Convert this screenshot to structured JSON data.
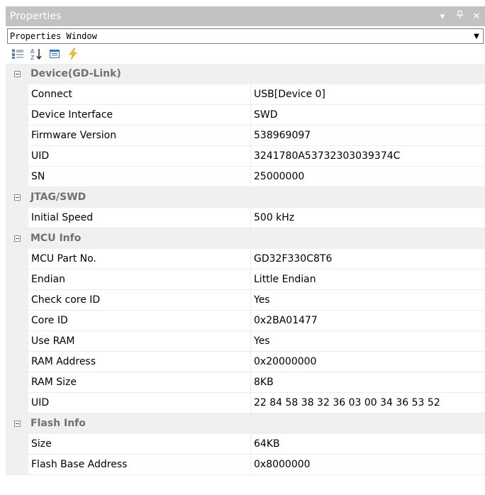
{
  "titlebar": {
    "title": "Properties",
    "dropdown_glyph": "▾",
    "pin_glyph": "ᵽ",
    "close_glyph": "✕"
  },
  "object_selector": {
    "value": "Properties Window",
    "arrow_glyph": "▼"
  },
  "toolbar": {
    "tools": [
      {
        "icon": "categorized-icon"
      },
      {
        "icon": "alphabetical-sort-icon"
      },
      {
        "icon": "property-pages-icon"
      },
      {
        "icon": "events-icon"
      }
    ]
  },
  "colors": {
    "titlebar_bg": "#c2c2c2",
    "category_bg": "#f0f0f0",
    "category_text": "#707070",
    "grid_line": "#ececec",
    "events_icon": "#f5c518"
  },
  "categories": [
    {
      "name": "Device(GD-Link)",
      "properties": [
        {
          "name": "Connect",
          "value": "USB[Device 0]"
        },
        {
          "name": "Device Interface",
          "value": "SWD"
        },
        {
          "name": "Firmware Version",
          "value": "538969097"
        },
        {
          "name": "UID",
          "value": "3241780A53732303039374C"
        },
        {
          "name": "SN",
          "value": "25000000"
        }
      ]
    },
    {
      "name": "JTAG/SWD",
      "properties": [
        {
          "name": "Initial Speed",
          "value": "500 kHz"
        }
      ]
    },
    {
      "name": "MCU Info",
      "properties": [
        {
          "name": "MCU Part No.",
          "value": "GD32F330C8T6"
        },
        {
          "name": "Endian",
          "value": "Little Endian"
        },
        {
          "name": "Check core ID",
          "value": "Yes"
        },
        {
          "name": "Core ID",
          "value": "0x2BA01477"
        },
        {
          "name": "Use RAM",
          "value": "Yes"
        },
        {
          "name": "RAM Address",
          "value": "0x20000000"
        },
        {
          "name": "RAM Size",
          "value": "8KB"
        },
        {
          "name": "UID",
          "value": "22 84 58 38 32 36 03 00 34 36 53 52"
        }
      ]
    },
    {
      "name": "Flash Info",
      "properties": [
        {
          "name": "Size",
          "value": "64KB"
        },
        {
          "name": "Flash Base Address",
          "value": "0x8000000"
        }
      ]
    }
  ]
}
